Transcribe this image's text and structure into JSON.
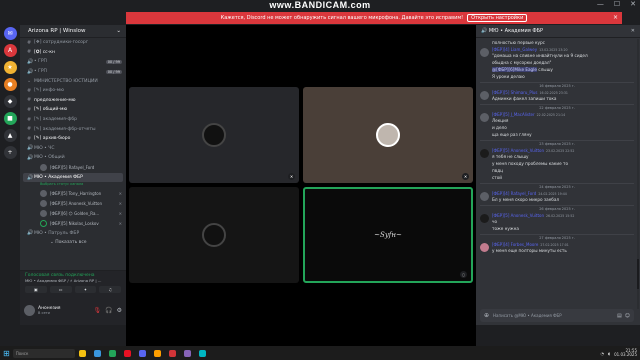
{
  "watermark": "www.BANDICAM.com",
  "notice": {
    "text": "Кажется, Discord не может обнаружить сигнал вашего микрофона. Давайте это исправим!",
    "button": "Открыть настройки",
    "close": "×"
  },
  "window_controls": {
    "minimize": "—",
    "maximize": "☐",
    "close": "✕"
  },
  "guild": {
    "name": "Arizona RP | Winslow"
  },
  "channels": [
    {
      "icon": "#",
      "label": "[❖] сотрудники-госорг",
      "bold": false
    },
    {
      "icon": "#",
      "label": "[✪] cc-кн",
      "bold": true
    },
    {
      "icon": "🔊",
      "label": "• ГРП",
      "bold": false,
      "badge": "00  /  99"
    },
    {
      "icon": "🔊",
      "label": "• ГРП",
      "bold": false,
      "badge": "00  /  99"
    }
  ],
  "category": "МИНИСТЕРСТВО ЮСТИЦИИ",
  "channels2": [
    {
      "icon": "#",
      "label": "[✎] инфо-мю",
      "bold": false
    },
    {
      "icon": "#",
      "label": "предложение-мю",
      "bold": true
    },
    {
      "icon": "#",
      "label": "[✎] общий-мю",
      "bold": true
    },
    {
      "icon": "#",
      "label": "[✎] академия-фбр",
      "bold": false
    },
    {
      "icon": "#",
      "label": "[✎] академия-фбр-отчеты",
      "bold": false
    },
    {
      "icon": "#",
      "label": "[✎] архив-бюро",
      "bold": true
    },
    {
      "icon": "🔊",
      "label": "МЮ • ЧС",
      "bold": false
    },
    {
      "icon": "🔊",
      "label": "МЮ • Общий",
      "bold": false
    }
  ],
  "voice_user_top": "[ФБР][5] Rafayel_Ford",
  "active_channel": {
    "icon": "🔊",
    "label": "МЮ • Академия ФБР",
    "subtitle": "Выбрать статус канала"
  },
  "voice_users": [
    {
      "name": "[ФБР][5] Tony_Harrington"
    },
    {
      "name": "[ФБР][5] Anonesk_Vuitton"
    },
    {
      "name": "[ФБР][6] 😊 Golden_Ra..."
    },
    {
      "name": "[ФБР][5] Nikolas_Loskov"
    }
  ],
  "channel_after": {
    "icon": "🔊",
    "label": "МЮ • Патруль ФБР"
  },
  "show_all": "Показать все",
  "voice_panel": {
    "status": "Голосовая связь подключена",
    "channel": "МЮ • Академия ФБР / ⚡ Arizona RP | ..."
  },
  "user_panel": {
    "name": "Анонезия",
    "status": "В сети"
  },
  "chat": {
    "title": "МЮ • Академия ФБР",
    "input_placeholder": "Написать @МЮ • Академия ФБР"
  },
  "messages": [
    {
      "type": "cont",
      "text": "полностью первые курс"
    },
    {
      "type": "msg",
      "author": "[ФБР][4] Liam_Galwey",
      "time": "13.02.2025 23:20",
      "lines": [
        "\"домаша на сливне инвайтнули на 9 сидел",
        "обыдна с мусорки доедал\""
      ],
      "mention": "@[ФБР][6]Mike Eagle",
      "mention_after": " слышу"
    },
    {
      "type": "cont",
      "text": "Я уроки делаю"
    },
    {
      "type": "date",
      "text": "16 февраля 2025 г."
    },
    {
      "type": "msg",
      "author": "[ФБР][5] Shimaru_Plus",
      "time": "16.02.2025 23:31",
      "lines": [
        "Админки факел запиши тока"
      ]
    },
    {
      "type": "date",
      "text": "22 февраля 2025 г."
    },
    {
      "type": "msg",
      "author": "[ФБР][5] J_MacAlister",
      "time": "22.02.2025 21:14",
      "lines": [
        "Лекция",
        "и дело"
      ]
    },
    {
      "type": "cont",
      "text": "ща еще раз гляну"
    },
    {
      "type": "date",
      "text": "23 февраля 2025 г."
    },
    {
      "type": "msg",
      "author": "[ФБР][5] Anonesk_Vuitton",
      "time": "23.02.2025 22:52",
      "lines": [
        "я тебя не слышу",
        "у меня походу проблемы какие то"
      ],
      "dark": true
    },
    {
      "type": "cont",
      "text": "пвдц"
    },
    {
      "type": "cont",
      "text": "стой"
    },
    {
      "type": "date",
      "text": "24 февраля 2025 г."
    },
    {
      "type": "msg",
      "author": "[ФБР][4] Rafayel_Ford",
      "time": "24.02.2025 19:44",
      "lines": [
        "Бл у меня скоро микро заебал"
      ]
    },
    {
      "type": "date",
      "text": "26 февраля 2025 г."
    },
    {
      "type": "msg",
      "author": "[ФБР][5] Anonesk_Vuitton",
      "time": "26.02.2025 15:52",
      "lines": [
        "чо",
        "тоже нужна"
      ],
      "dark": true
    },
    {
      "type": "date",
      "text": "27 февраля 2025 г."
    },
    {
      "type": "msg",
      "author": "[ФБР][4] Forbes_Moore",
      "time": "27.02.2025 17:01",
      "lines": [
        "у меня еще полторы минуты есть"
      ],
      "pink": true
    }
  ],
  "taskbar": {
    "search": "Поиск",
    "time": "21:55",
    "date": "01.03.2025"
  },
  "colors": {
    "accent": "#5865f2",
    "online": "#23a559",
    "danger": "#da373c"
  }
}
